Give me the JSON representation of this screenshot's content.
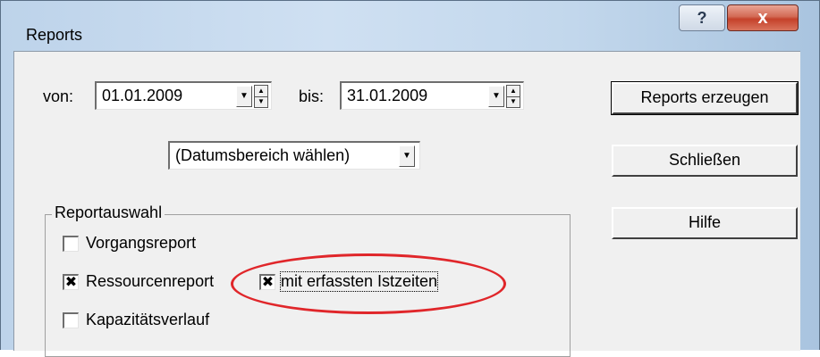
{
  "window": {
    "title": "Reports",
    "help_glyph": "?",
    "close_glyph": "x"
  },
  "dates": {
    "from_label": "von:",
    "from_value": "01.01.2009",
    "to_label": "bis:",
    "to_value": "31.01.2009",
    "range_select": "(Datumsbereich wählen)"
  },
  "buttons": {
    "generate": "Reports erzeugen",
    "close": "Schließen",
    "help": "Hilfe"
  },
  "report_group": {
    "title": "Reportauswahl",
    "items": [
      {
        "label": "Vorgangsreport",
        "checked": false
      },
      {
        "label": "Ressourcenreport",
        "checked": true
      },
      {
        "label": "mit erfassten Istzeiten",
        "checked": true
      },
      {
        "label": "Kapazitätsverlauf",
        "checked": false
      }
    ]
  },
  "glyphs": {
    "check": "✖",
    "dropdown": "▼",
    "spin_up": "▲",
    "spin_down": "▼"
  },
  "colors": {
    "highlight_ellipse": "#e0262a",
    "title_bar": "#c2d7ec",
    "close_button": "#c5412a"
  }
}
